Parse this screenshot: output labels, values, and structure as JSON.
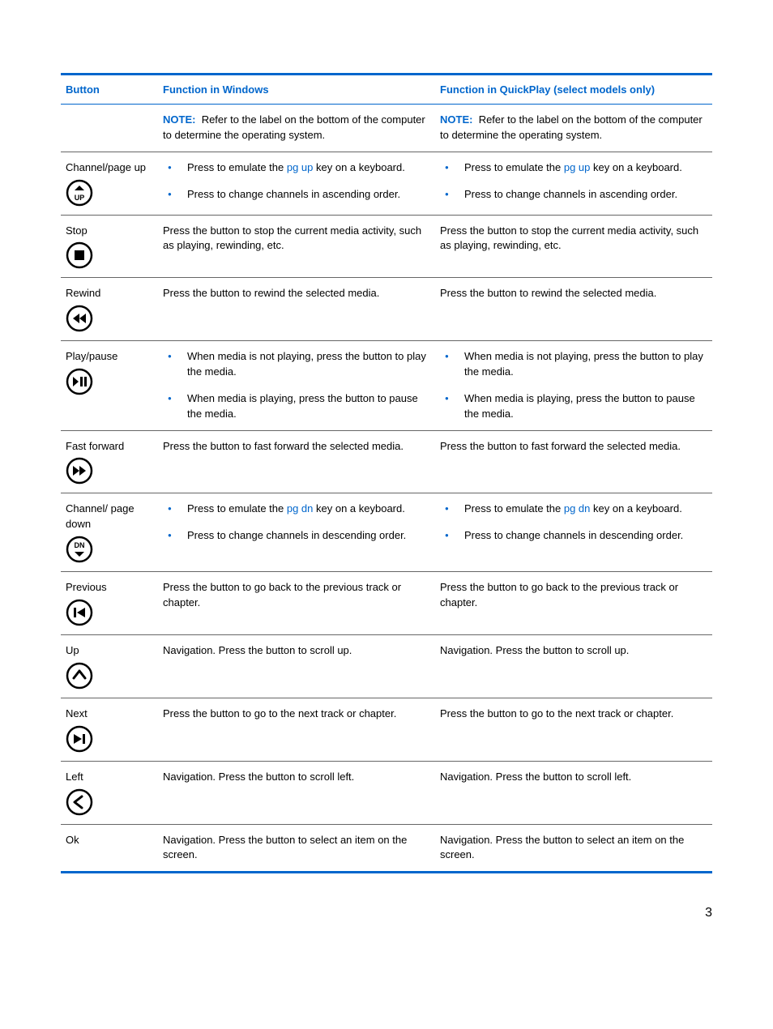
{
  "headers": {
    "button": "Button",
    "windows": "Function in Windows",
    "quickplay": "Function in QuickPlay (select models only)"
  },
  "subheader": {
    "noteLabel": "NOTE:",
    "noteText": "Refer to the label on the bottom of the computer to determine the operating system."
  },
  "rows": {
    "channel_up": {
      "label": "Channel/page up",
      "b1a": "Press to emulate the ",
      "b1key": "pg up",
      "b1b": " key on a keyboard.",
      "b2": "Press to change channels in ascending order."
    },
    "stop": {
      "label": "Stop",
      "text": "Press the button to stop the current media activity, such as playing, rewinding, etc."
    },
    "rewind": {
      "label": "Rewind",
      "text": "Press the button to rewind the selected media."
    },
    "playpause": {
      "label": "Play/pause",
      "b1": "When media is not playing, press the button to play the media.",
      "b2": "When media is playing, press the button to pause the media."
    },
    "fastforward": {
      "label": "Fast forward",
      "text": "Press the button to fast forward the selected media."
    },
    "channel_down": {
      "label": "Channel/ page down",
      "b1a": "Press to emulate the ",
      "b1key": "pg dn",
      "b1b": " key on a keyboard.",
      "b2": "Press to change channels in descending order."
    },
    "previous": {
      "label": "Previous",
      "text": "Press the button to go back to the previous track or chapter."
    },
    "up": {
      "label": "Up",
      "text": "Navigation. Press the button to scroll up."
    },
    "next": {
      "label": "Next",
      "text": "Press the button to go to the next track or chapter."
    },
    "left": {
      "label": "Left",
      "text": "Navigation. Press the button to scroll left."
    },
    "ok": {
      "label": "Ok",
      "text": "Navigation. Press the button to select an item on the screen."
    }
  },
  "pageNumber": "3"
}
